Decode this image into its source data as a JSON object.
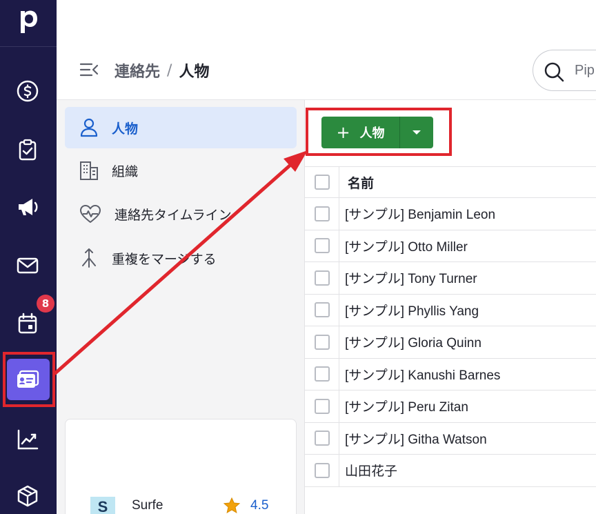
{
  "rail": {
    "logo_letter": "p",
    "items": [
      {
        "icon": "dollar-circle-icon"
      },
      {
        "icon": "clipboard-check-icon"
      },
      {
        "icon": "megaphone-icon"
      },
      {
        "icon": "mail-icon"
      },
      {
        "icon": "calendar-icon",
        "badge": "8"
      },
      {
        "icon": "contact-card-icon",
        "active": true
      },
      {
        "icon": "chart-line-icon"
      },
      {
        "icon": "box-icon"
      }
    ]
  },
  "header": {
    "breadcrumb_parent": "連絡先",
    "breadcrumb_sep": "/",
    "breadcrumb_current": "人物",
    "search_placeholder": "Pip"
  },
  "subnav": {
    "items": [
      {
        "label": "人物",
        "icon": "person-icon",
        "active": true
      },
      {
        "label": "組織",
        "icon": "building-icon"
      },
      {
        "label": "連絡先タイムライン",
        "icon": "heart-pulse-icon"
      },
      {
        "label": "重複をマージする",
        "icon": "merge-icon"
      }
    ]
  },
  "marketplace": {
    "app_logo": "S",
    "app_name": "Surfe",
    "rating": "4.5"
  },
  "main": {
    "add_button_label": "人物",
    "add_button_plus": "+",
    "table": {
      "header": "名前",
      "rows": [
        "[サンプル] Benjamin Leon",
        "[サンプル] Otto Miller",
        "[サンプル] Tony Turner",
        "[サンプル] Phyllis Yang",
        "[サンプル] Gloria Quinn",
        "[サンプル] Kanushi Barnes",
        "[サンプル] Peru Zitan",
        "[サンプル] Githa Watson",
        "山田花子"
      ]
    }
  },
  "colors": {
    "rail_bg": "#1c1a47",
    "rail_active": "#6b5be6",
    "primary_green": "#2b8a3e",
    "link_blue": "#1a5fcc",
    "annotation_red": "#e0262d"
  }
}
